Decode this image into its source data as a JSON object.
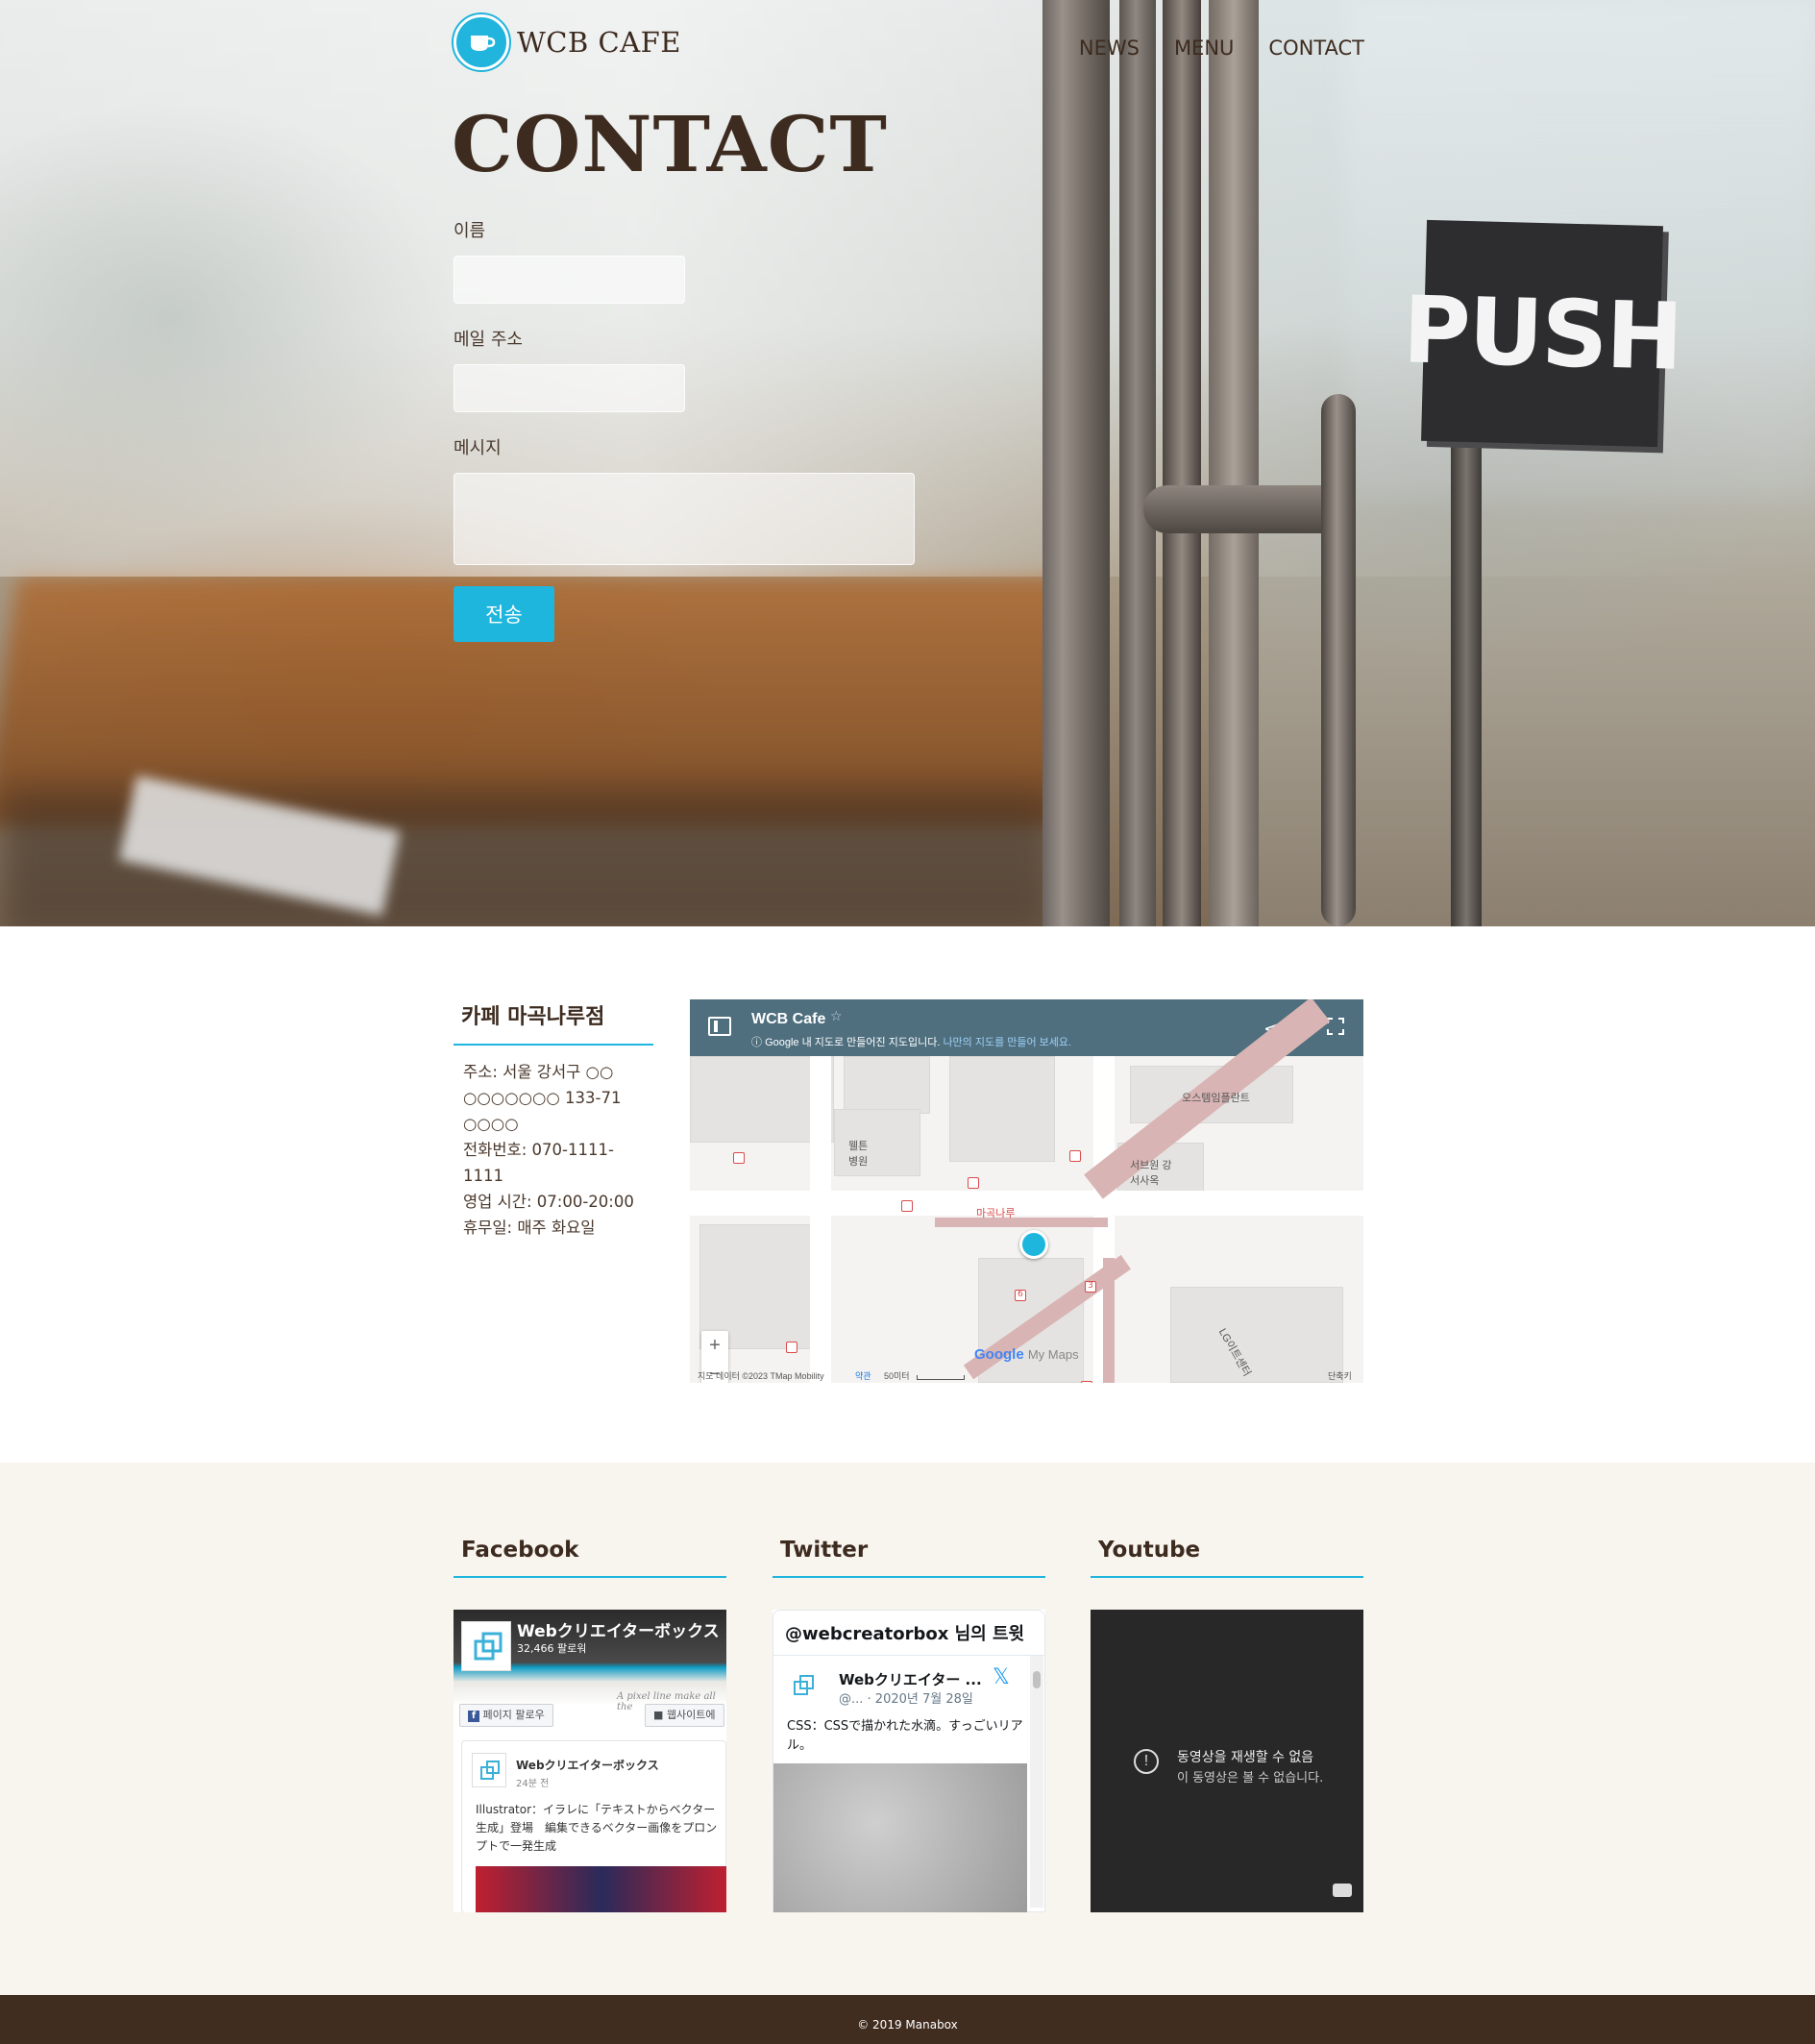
{
  "header": {
    "logo_text": "WCB CAFE",
    "nav": [
      "NEWS",
      "MENU",
      "CONTACT"
    ]
  },
  "hero": {
    "title": "CONTACT",
    "sign_text": "PUSH"
  },
  "form": {
    "name_label": "이름",
    "email_label": "메일 주소",
    "message_label": "메시지",
    "submit_label": "전송"
  },
  "info": {
    "title": "카페 마곡나루점",
    "address_line1": "주소: 서울 강서구 ○○",
    "address_line2": "○○○○○○○ 133-71",
    "address_line3": "○○○○",
    "phone": "전화번호: 070-1111-1111",
    "hours": "영업 시간: 07:00-20:00",
    "closed": "휴무일: 매주 화요일"
  },
  "map": {
    "title": "WCB Cafe",
    "subtitle": "Google 내 지도로 만들어진 지도입니다.",
    "subtitle_link": "나만의 지도를 만들어 보세요.",
    "labels": {
      "l1": "오스템임플란트",
      "l2": "웰튼 병원",
      "l3": "서브원 강서사옥",
      "l4": "마곡나루",
      "l5": "LG이트센터",
      "stop6": "6",
      "stop3": "3"
    },
    "zoom_in": "+",
    "zoom_out": "−",
    "google_logo": "Google",
    "my_maps": "My Maps",
    "footer_data": "지도 데이터 ©2023 TMap Mobility",
    "footer_terms": "약관",
    "footer_scale": "50미터",
    "footer_shortcut": "단축키"
  },
  "social": {
    "facebook": {
      "title": "Facebook",
      "page_name": "Webクリエイターボックス",
      "followers": "32,466 팔로워",
      "follow_btn": "페이지 팔로우",
      "site_btn": "웹사이트에",
      "cover_script": "A pixel line make all the",
      "post_name": "Webクリエイターボックス",
      "post_time": "24분 전",
      "post_text": "Illustrator：イラレに「テキストからベクター生成」登場　編集できるベクター画像をプロンプトで一発生成"
    },
    "twitter": {
      "title": "Twitter",
      "header": "@webcreatorbox 님의 트윗",
      "name": "Webクリエイター ...",
      "handle": "@... · 2020년 7월 28일",
      "text": "CSS：CSSで描かれた水滴。すっごいリアル。"
    },
    "youtube": {
      "title": "Youtube",
      "error_title": "동영상을 재생할 수 없음",
      "error_body": "이 동영상은 볼 수 없습니다."
    }
  },
  "footer": {
    "copyright": "© 2019 Manabox"
  },
  "colors": {
    "accent": "#1fb6de",
    "brown": "#3d2b1f",
    "footer_bg": "#412d20",
    "social_bg": "#f8f5ef"
  }
}
